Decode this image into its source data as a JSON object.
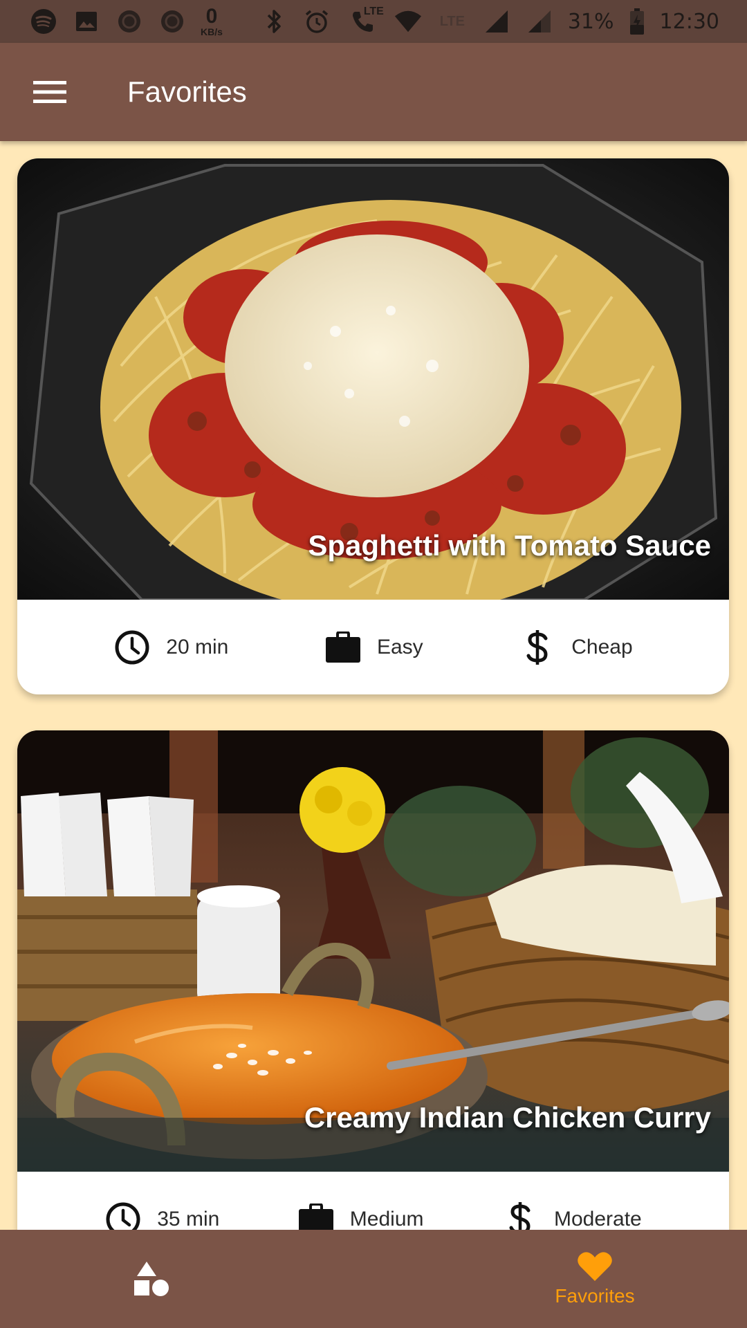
{
  "status_bar": {
    "net_speed_value": "0",
    "net_speed_unit": "KB/s",
    "lte_label": "LTE",
    "battery_percent": "31%",
    "time": "12:30"
  },
  "app_bar": {
    "title": "Favorites"
  },
  "meals": [
    {
      "title": "Spaghetti with Tomato Sauce",
      "duration": "20 min",
      "complexity": "Easy",
      "affordability": "Cheap"
    },
    {
      "title": "Creamy Indian Chicken Curry",
      "duration": "35 min",
      "complexity": "Medium",
      "affordability": "Moderate"
    }
  ],
  "bottom_nav": {
    "tabs": [
      {
        "icon": "categories-icon",
        "label": ""
      },
      {
        "icon": "heart-icon",
        "label": "Favorites",
        "active": true
      }
    ]
  },
  "colors": {
    "primary": "#7B5447",
    "status_bar": "#5E433A",
    "background": "#FFE8B8",
    "accent": "#FF9F0A",
    "card": "#FFFFFF"
  }
}
